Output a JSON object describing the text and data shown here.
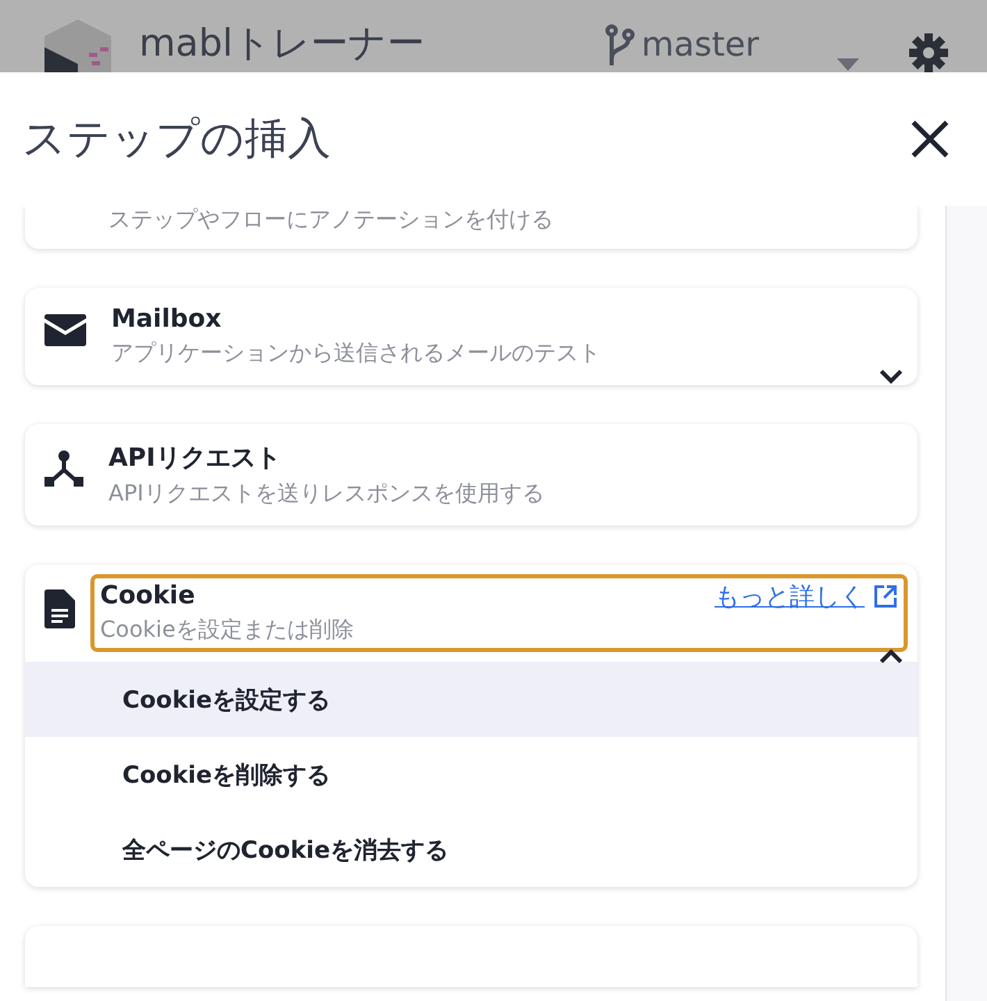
{
  "app_header": {
    "title": "mablトレーナー",
    "branch": "master"
  },
  "dialog": {
    "title": "ステップの挿入",
    "steps": [
      {
        "kind": "annotation",
        "description": "ステップやフローにアノテーションを付ける"
      },
      {
        "kind": "mailbox",
        "title": "Mailbox",
        "description": "アプリケーションから送信されるメールのテスト",
        "expanded": false,
        "focused": false
      },
      {
        "kind": "api",
        "title": "APIリクエスト",
        "description": "APIリクエストを送りレスポンスを使用する",
        "focused": false
      },
      {
        "kind": "cookie",
        "title": "Cookie",
        "description": "Cookieを設定または削除",
        "expanded": true,
        "focused": true,
        "link": "もっと詳しく",
        "actions": [
          {
            "label": "Cookieを設定する",
            "selected": true
          },
          {
            "label": "Cookieを削除する",
            "selected": false
          },
          {
            "label": "全ページのCookieを消去する",
            "selected": false
          }
        ]
      }
    ]
  }
}
